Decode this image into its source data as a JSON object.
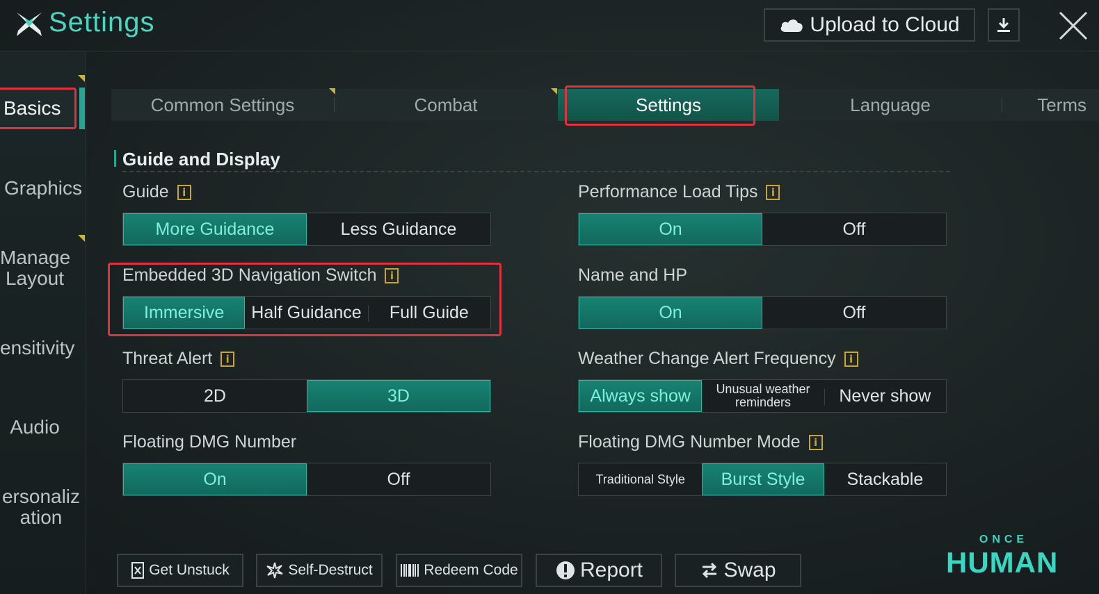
{
  "app": {
    "title": "Settings",
    "upload_label": "Upload to Cloud"
  },
  "sidebar": {
    "items": [
      {
        "label": "Basics"
      },
      {
        "label": "Graphics"
      },
      {
        "label": "Manage Layout"
      },
      {
        "label": "ensitivity"
      },
      {
        "label": "Audio"
      },
      {
        "label": "ersonaliz ation"
      }
    ]
  },
  "tabs": [
    {
      "label": "Common Settings"
    },
    {
      "label": "Combat"
    },
    {
      "label": "Settings"
    },
    {
      "label": "Language"
    },
    {
      "label": "Terms"
    }
  ],
  "section": {
    "title": "Guide and Display"
  },
  "settings": {
    "guide": {
      "label": "Guide",
      "options": [
        "More Guidance",
        "Less Guidance"
      ],
      "selected": "More Guidance"
    },
    "performance_load_tips": {
      "label": "Performance Load Tips",
      "options": [
        "On",
        "Off"
      ],
      "selected": "On"
    },
    "embedded_nav": {
      "label": "Embedded 3D Navigation Switch",
      "options": [
        "Immersive",
        "Half Guidance",
        "Full Guide"
      ],
      "selected": "Immersive"
    },
    "name_hp": {
      "label": "Name and HP",
      "options": [
        "On",
        "Off"
      ],
      "selected": "On"
    },
    "threat_alert": {
      "label": "Threat Alert",
      "options": [
        "2D",
        "3D"
      ],
      "selected": "3D"
    },
    "weather_alert": {
      "label": "Weather Change Alert Frequency",
      "options": [
        "Always show",
        "Unusual weather reminders",
        "Never show"
      ],
      "selected": "Always show"
    },
    "floating_dmg": {
      "label": "Floating DMG Number",
      "options": [
        "On",
        "Off"
      ],
      "selected": "On"
    },
    "floating_dmg_mode": {
      "label": "Floating DMG Number Mode",
      "options": [
        "Traditional Style",
        "Burst Style",
        "Stackable"
      ],
      "selected": "Burst Style"
    }
  },
  "bottom": {
    "get_unstuck": "Get Unstuck",
    "self_destruct": "Self-Destruct",
    "redeem_code": "Redeem Code",
    "report": "Report",
    "swap": "Swap"
  },
  "brand": {
    "top": "ONCE",
    "bottom": "HUMAN"
  },
  "colors": {
    "accent": "#2aa592",
    "highlight": "#e0313f",
    "brand": "#38d7c2"
  },
  "icons": [
    "game-logo-icon",
    "cloud-icon",
    "download-icon",
    "close-icon",
    "info-icon",
    "phone-icon",
    "self-destruct-icon",
    "barcode-icon",
    "alert-icon",
    "swap-icon"
  ]
}
